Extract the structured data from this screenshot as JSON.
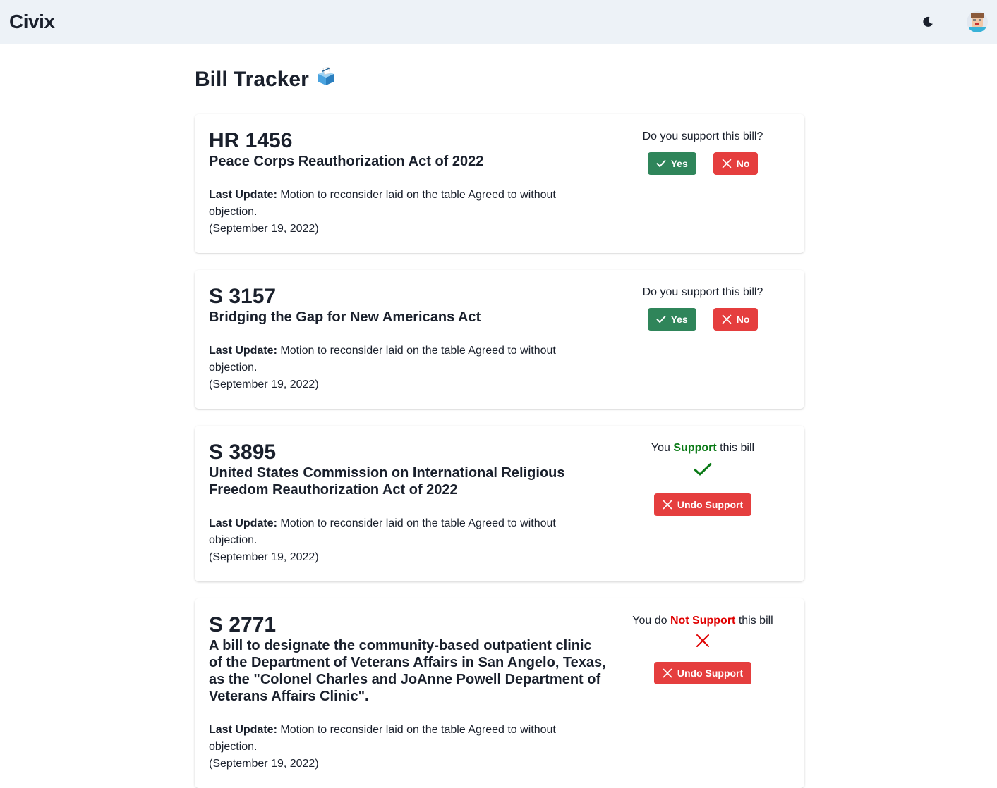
{
  "app": {
    "brand": "Civix"
  },
  "header": {
    "theme_icon": "moon-icon",
    "avatar_icon": "user-avatar"
  },
  "page": {
    "title": "Bill Tracker",
    "title_icon": "ballot-box-icon"
  },
  "labels": {
    "question": "Do you support this bill?",
    "yes": "Yes",
    "no": "No",
    "last_update": "Last Update:",
    "undo": "Undo Support",
    "you": "You",
    "you_do": "You do",
    "support": "Support",
    "not_support": "Not Support",
    "this_bill": "this bill"
  },
  "bills": [
    {
      "number": "HR 1456",
      "title": "Peace Corps Reauthorization Act of 2022",
      "update_text": "Motion to reconsider laid on the table Agreed to without objection.",
      "update_date": "(September 19, 2022)",
      "state": "undecided"
    },
    {
      "number": "S 3157",
      "title": "Bridging the Gap for New Americans Act",
      "update_text": "Motion to reconsider laid on the table Agreed to without objection.",
      "update_date": "(September 19, 2022)",
      "state": "undecided"
    },
    {
      "number": "S 3895",
      "title": "United States Commission on International Religious Freedom Reauthorization Act of 2022",
      "update_text": "Motion to reconsider laid on the table Agreed to without objection.",
      "update_date": "(September 19, 2022)",
      "state": "supported"
    },
    {
      "number": "S 2771",
      "title": "A bill to designate the community-based outpatient clinic of the Department of Veterans Affairs in San Angelo, Texas, as the \"Colonel Charles and JoAnne Powell Department of Veterans Affairs Clinic\".",
      "update_text": "Motion to reconsider laid on the table Agreed to without objection.",
      "update_date": "(September 19, 2022)",
      "state": "not_supported"
    }
  ],
  "colors": {
    "yes": "#2f855a",
    "no": "#e53e3e",
    "support_text": "#0a7a16",
    "not_support_text": "#e00000",
    "header_bg": "#edf2f7"
  }
}
